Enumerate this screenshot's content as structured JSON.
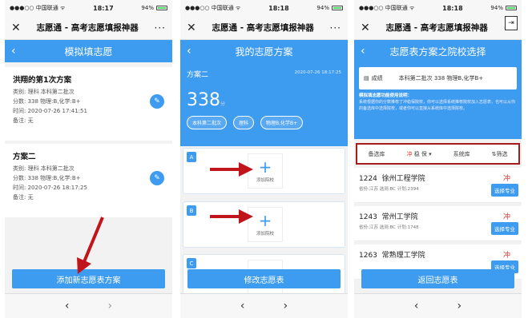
{
  "status": {
    "carrier": "●●●○○ 中国联通 ᯤ",
    "battery": "94%",
    "times": [
      "18:17",
      "18:18",
      "18:18"
    ]
  },
  "wx": {
    "close": "✕",
    "title": "志愿通 - 高考志愿填报神器",
    "more": "···"
  },
  "icons": {
    "back": "‹",
    "nav_back": "‹",
    "nav_forward": "›",
    "edit": "✎",
    "plus": "+",
    "exit": "⇥",
    "doc": "▤"
  },
  "colors": {
    "primary": "#3d9bf0",
    "arrow": "#c0151b",
    "highlight": "#a51c1c",
    "risk": "#e8322c"
  },
  "phone1": {
    "header": "模拟填志愿",
    "plans": [
      {
        "name": "洪翔的第1次方案",
        "type": "类别:  理科    本科第二批次",
        "score": "分数:  338      物理:B,化学:B+",
        "time": "时间:  2020-07-26 17:41:51",
        "note": "备注:  无"
      },
      {
        "name": "方案二",
        "type": "类别:  理科    本科第二批次",
        "score": "分数:  338      物理:B,化学:B+",
        "time": "时间:  2020-07-26 18:17:25",
        "note": "备注:  无"
      }
    ],
    "button": "添加新志愿表方案"
  },
  "phone2": {
    "header": "我的志愿方案",
    "scheme_name": "方案二",
    "scheme_date": "2020-07-26 18:17:25",
    "score": "338",
    "score_unit": "分",
    "chips": [
      "本科第二批次",
      "理科",
      "物理B,化学B+"
    ],
    "slots": [
      {
        "tag": "A",
        "label": "添加院校"
      },
      {
        "tag": "B",
        "label": "添加院校"
      },
      {
        "tag": "C",
        "label": ""
      }
    ],
    "button": "修改志愿表"
  },
  "phone3": {
    "header": "志愿表方案之院校选择",
    "score_label": "成绩",
    "score_value": "本科第二批次  338 物理B,化学B+",
    "note_title": "模拟填志愿功能使用说明：",
    "note_text": "系统根据你的分数推荐了冲稳保院校，你可以选择系统推荐院校加入志愿表，也可以从你的备选库中选择院校，或者你可以直接从系统库中选择院校。",
    "filters": {
      "backup": "备选库",
      "chong": "冲",
      "wen": "稳",
      "bao": "保",
      "dropdown": "▾",
      "system": "系统库",
      "screen": "⇅筛选"
    },
    "schools": [
      {
        "code": "1224",
        "name": "徐州工程学院",
        "meta": "省份:江苏  选测:BC  计划:2394",
        "risk": "冲",
        "button": "选择专业"
      },
      {
        "code": "1243",
        "name": "常州工学院",
        "meta": "省份:江苏  选测:BC  计划:1748",
        "risk": "冲",
        "button": "选择专业"
      },
      {
        "code": "1263",
        "name": "常熟理工学院",
        "meta": "",
        "risk": "冲",
        "button": "选择专业"
      }
    ],
    "button": "返回志愿表"
  }
}
